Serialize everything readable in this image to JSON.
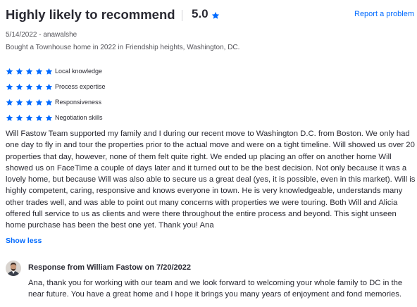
{
  "header": {
    "headline": "Highly likely to recommend",
    "overall_score": "5.0",
    "report_link": "Report a problem"
  },
  "meta": {
    "date_author": "5/14/2022 - anawalshe",
    "transaction": "Bought a Townhouse home in 2022 in Friendship heights, Washington, DC."
  },
  "ratings": [
    {
      "label": "Local knowledge",
      "stars": 5
    },
    {
      "label": "Process expertise",
      "stars": 5
    },
    {
      "label": "Responsiveness",
      "stars": 5
    },
    {
      "label": "Negotiation skills",
      "stars": 5
    }
  ],
  "review": {
    "text": "Will Fastow Team supported my family and I during our recent move to Washington D.C. from Boston. We only had one day to fly in and tour the properties prior to the actual move and were on a tight timeline. Will showed us over 20 properties that day, however, none of them felt quite right. We ended up placing an offer on another home Will showed us on FaceTime a couple of days later and it turned out to be the best decision. Not only because it was a lovely home, but because Will was also able to secure us a great deal (yes, it is possible, even in this market). Will is highly competent, caring, responsive and knows everyone in town. He is very knowledgeable, understands many other trades well, and was able to point out many concerns with properties we were touring. Both Will and Alicia offered full service to us as clients and were there throughout the entire process and beyond. This sight unseen home purchase has been the best one yet. Thank you! Ana",
    "toggle_label": "Show less"
  },
  "response": {
    "title": "Response from William Fastow on 7/20/2022",
    "text": "Ana, thank you for working with our team and we look forward to welcoming your whole family to DC in the near future. You have a great home and I hope it brings you many years of enjoyment and fond memories."
  },
  "colors": {
    "star": "#006aff",
    "link": "#006aff",
    "text": "#2a2a33",
    "muted": "#54545a"
  },
  "icons": {
    "star": "star-icon",
    "avatar": "avatar"
  }
}
